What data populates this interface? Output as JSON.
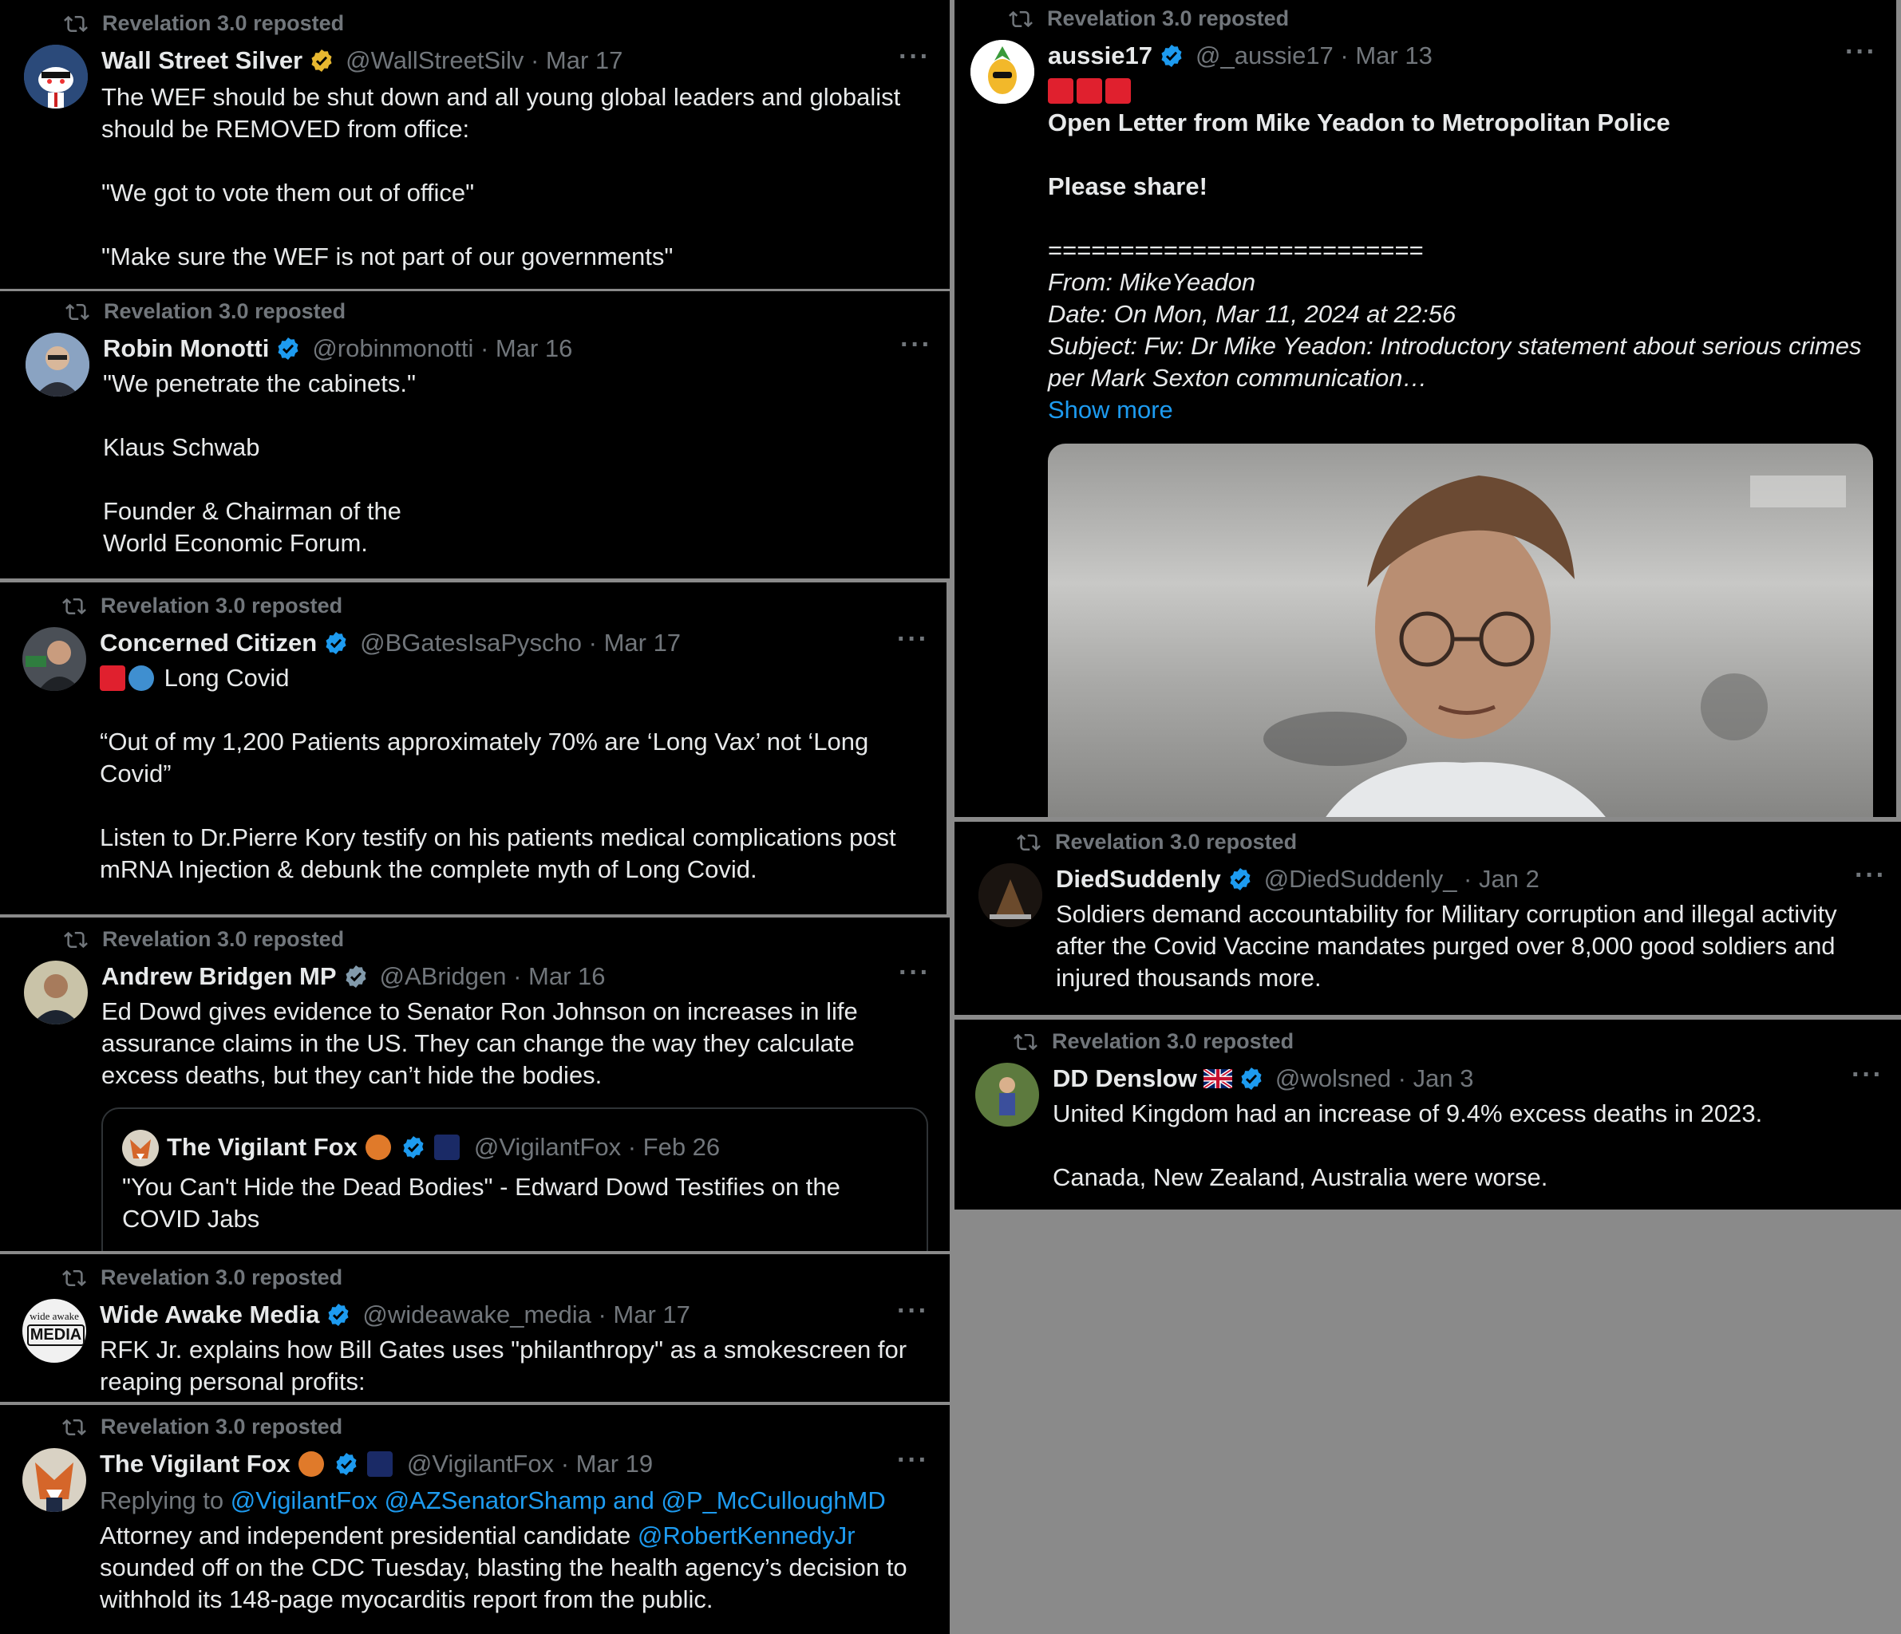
{
  "repost_label": "Revelation 3.0 reposted",
  "more_label": "···",
  "show_more": "Show more",
  "left_column": [
    {
      "name": "Wall Street Silver",
      "handle": "@WallStreetSilv · Mar 17",
      "lines": [
        "The WEF should be shut down and all young global leaders and globalist",
        "should be REMOVED from office:",
        "",
        "\"We got to vote them out of office\"",
        "",
        "\"Make sure the WEF is not part of our governments\""
      ]
    },
    {
      "name": "Robin Monotti",
      "handle": "@robinmonotti · Mar 16",
      "lines": [
        "\"We penetrate the cabinets.\"",
        "",
        "Klaus Schwab",
        "",
        "Founder & Chairman of the",
        "World Economic Forum."
      ]
    },
    {
      "name": "Concerned Citizen",
      "handle": "@BGatesIsaPyscho · Mar 17",
      "first_line": "Long Covid",
      "lines": [
        "",
        "“Out of my 1,200 Patients approximately 70% are ‘Long Vax’ not ‘Long",
        "Covid”",
        "",
        "Listen to Dr.Pierre Kory testify on his patients medical complications post",
        "mRNA Injection & debunk the complete myth of Long Covid."
      ]
    },
    {
      "name": "Andrew Bridgen MP",
      "handle": "@ABridgen · Mar 16",
      "lines": [
        "Ed Dowd gives evidence to Senator Ron Johnson on increases in life",
        "assurance claims in the US.  They can change the way they calculate",
        "excess deaths, but they can’t hide the bodies."
      ],
      "quote": {
        "name": "The Vigilant Fox",
        "handle": "@VigilantFox · Feb 26",
        "lines": [
          "\"You Can't Hide the Dead Bodies\" - Edward Dowd Testifies on the",
          "COVID Jabs"
        ]
      }
    },
    {
      "name": "Wide Awake Media",
      "handle": "@wideawake_media · Mar 17",
      "avatar_text_top": "wide awake",
      "avatar_text_bottom": "MEDIA",
      "lines": [
        "RFK Jr. explains how Bill Gates uses \"philanthropy\" as a smokescreen for",
        "reaping personal profits:"
      ]
    },
    {
      "name": "The Vigilant Fox",
      "handle": "@VigilantFox · Mar 19",
      "replying_to": "Replying to",
      "reply_handles": "@VigilantFox @AZSenatorShamp and @P_McCulloughMD",
      "line1_prefix": "Attorney and independent presidential candidate",
      "line1_link": "@RobertKennedyJr",
      "lines": [
        "sounded off on the CDC Tuesday, blasting the health agency’s decision to",
        "withhold its 148-page myocarditis report from the public."
      ]
    }
  ],
  "right_column": [
    {
      "name": "aussie17",
      "handle": "@_aussie17 · Mar 13",
      "title": "Open Letter from Mike Yeadon to Metropolitan Police",
      "share": "Please share!",
      "divider": "==========================",
      "italic_lines": [
        "From: MikeYeadon",
        "Date: On Mon, Mar 11, 2024 at 22:56",
        "Subject: Fw: Dr Mike Yeadon: Introductory statement about serious crimes",
        "per Mark Sexton communication…"
      ]
    },
    {
      "name": "DiedSuddenly",
      "handle": "@DiedSuddenly_ · Jan 2",
      "lines": [
        "Soldiers demand accountability for Military corruption and illegal activity",
        "after the Covid Vaccine mandates purged over 8,000 good soldiers and",
        "injured thousands more."
      ]
    },
    {
      "name": "DD Denslow",
      "handle": "@wolsned · Jan 3",
      "lines": [
        "United Kingdom had an increase of 9.4% excess deaths in 2023.",
        "",
        "Canada, New Zealand, Australia were worse."
      ]
    }
  ],
  "colors": {
    "background": "#000000",
    "text": "#e7e9ea",
    "muted": "#71767b",
    "link": "#1d9bf0",
    "gold_badge": "#e8b830",
    "blue_badge": "#1d9bf0",
    "grey_badge": "#829aab"
  }
}
